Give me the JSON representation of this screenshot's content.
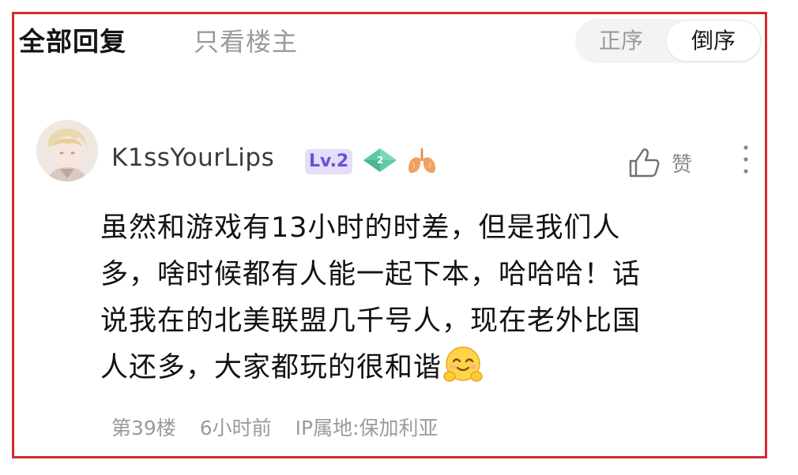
{
  "tabs": {
    "all_replies": "全部回复",
    "only_op": "只看楼主"
  },
  "sort": {
    "ascending": "正序",
    "descending": "倒序",
    "active": "descending"
  },
  "comment": {
    "username": "K1ssYourLips",
    "level": "Lv.2",
    "gem_number": "2",
    "like_label": "赞",
    "lines": [
      "虽然和游戏有13小时的时差，但是我们人",
      "多，啥时候都有人能一起下本，哈哈哈！话",
      "说我在的北美联盟几千号人，现在老外比国",
      "人还多，大家都玩的很和谐"
    ],
    "floor": "第39楼",
    "time": "6小时前",
    "ip": "IP属地:保加利亚"
  },
  "icons": {
    "avatar": "anime-avatar",
    "gem": "green-gem-badge-icon",
    "lung": "lung-badge-icon",
    "like": "thumbs-up-icon",
    "more": "more-vertical-icon",
    "emoji": "smiling-face-emoji"
  },
  "colors": {
    "frame_border": "#d42a2f",
    "level_badge_bg": "#e4def8",
    "level_badge_text": "#6d4fd8",
    "gem": "#5fc9a7",
    "lung": "#f0a060"
  }
}
